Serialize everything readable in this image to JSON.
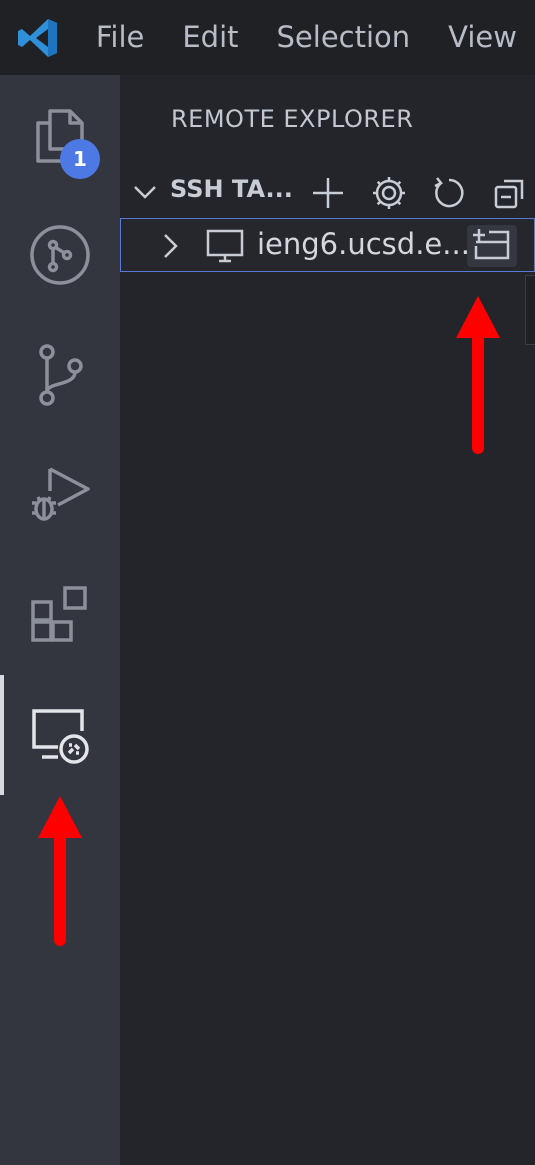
{
  "menu": {
    "items": [
      "File",
      "Edit",
      "Selection",
      "View"
    ]
  },
  "activity_bar": {
    "items": [
      {
        "name": "explorer",
        "icon": "files-icon",
        "badge": "1"
      },
      {
        "name": "github",
        "icon": "github-icon"
      },
      {
        "name": "source-control",
        "icon": "source-control-icon"
      },
      {
        "name": "run-and-debug",
        "icon": "debug-icon"
      },
      {
        "name": "extensions",
        "icon": "extensions-icon"
      },
      {
        "name": "remote-explorer",
        "icon": "remote-explorer-icon",
        "active": true
      }
    ]
  },
  "sidebar": {
    "title": "REMOTE EXPLORER",
    "section": {
      "title": "SSH TA...",
      "actions": [
        "add-icon",
        "gear-icon",
        "refresh-icon",
        "collapse-all-icon"
      ]
    },
    "tree": [
      {
        "label": "ieng6.ucsd.e...",
        "icon": "monitor-icon",
        "action_icon": "open-in-new-window-icon"
      }
    ]
  },
  "annotations": [
    {
      "type": "red-arrow",
      "points_to": "open-in-new-window-button"
    },
    {
      "type": "red-arrow",
      "points_to": "activity-remote-explorer"
    }
  ],
  "colors": {
    "accent": "#4d79e5",
    "selection_border": "#5a78d6",
    "annotation": "#ff0000",
    "activity_bar": "#33353f",
    "sidebar": "#23252b"
  }
}
